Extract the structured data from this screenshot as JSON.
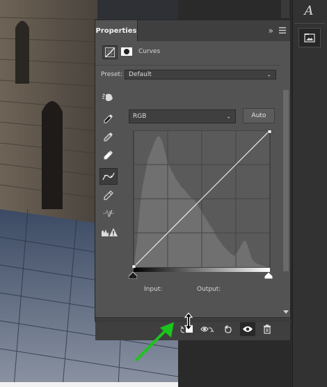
{
  "panel": {
    "tab_label": "Properties",
    "menu_chevrons": "»",
    "adjustment_name": "Curves"
  },
  "preset": {
    "label": "Preset:",
    "value": "Default"
  },
  "channel": {
    "value": "RGB",
    "auto_label": "Auto"
  },
  "readout": {
    "input_label": "Input:",
    "output_label": "Output:"
  },
  "right_tools": {
    "text_tool_glyph": "A"
  },
  "icons": {
    "cursor": "vertical-resize-icon",
    "annotation": "green-arrow"
  },
  "colors": {
    "panel_bg": "#535353",
    "header_bg": "#3f3f3f",
    "graph_bg": "#5a5a5a",
    "histogram": "#6e6e6e",
    "curve": "#ffffff",
    "annotation_arrow": "#1bc41b"
  }
}
